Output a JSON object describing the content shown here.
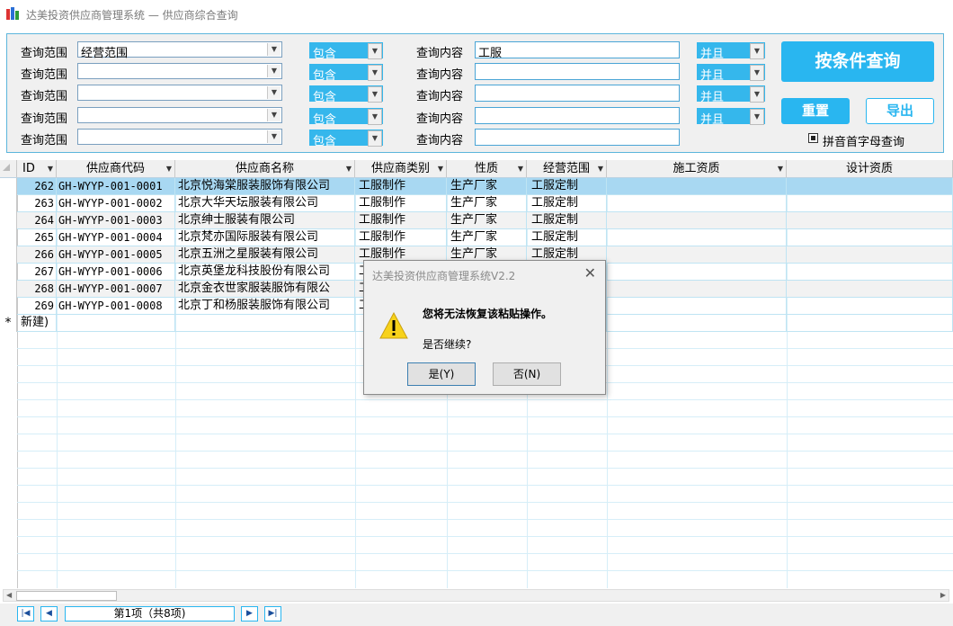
{
  "window": {
    "title": "达美投资供应商管理系统 — 供应商综合查询"
  },
  "search": {
    "rows": [
      {
        "range_label": "查询范围",
        "range_value": "经营范围",
        "op": "包含",
        "content_label": "查询内容",
        "content_value": "工服",
        "logic": "并且"
      },
      {
        "range_label": "查询范围",
        "range_value": "",
        "op": "包含",
        "content_label": "查询内容",
        "content_value": "",
        "logic": "并且"
      },
      {
        "range_label": "查询范围",
        "range_value": "",
        "op": "包含",
        "content_label": "查询内容",
        "content_value": "",
        "logic": "并且"
      },
      {
        "range_label": "查询范围",
        "range_value": "",
        "op": "包含",
        "content_label": "查询内容",
        "content_value": "",
        "logic": "并且"
      },
      {
        "range_label": "查询范围",
        "range_value": "",
        "op": "包含",
        "content_label": "查询内容",
        "content_value": ""
      }
    ],
    "query_button": "按条件查询",
    "reset_button": "重置",
    "export_button": "导出",
    "pinyin_label": "拼音首字母查询",
    "pinyin_checked": true
  },
  "grid": {
    "columns": [
      "ID",
      "供应商代码",
      "供应商名称",
      "供应商类别",
      "性质",
      "经营范围",
      "施工资质",
      "设计资质"
    ],
    "rows": [
      {
        "id": "262",
        "code": "GH-WYYP-001-0001",
        "name": "北京悦海棠服装服饰有限公司",
        "category": "工服制作",
        "nature": "生产厂家",
        "scope": "工服定制"
      },
      {
        "id": "263",
        "code": "GH-WYYP-001-0002",
        "name": "北京大华天坛服装有限公司",
        "category": "工服制作",
        "nature": "生产厂家",
        "scope": "工服定制"
      },
      {
        "id": "264",
        "code": "GH-WYYP-001-0003",
        "name": "北京绅士服装有限公司",
        "category": "工服制作",
        "nature": "生产厂家",
        "scope": "工服定制"
      },
      {
        "id": "265",
        "code": "GH-WYYP-001-0004",
        "name": "北京梵亦国际服装有限公司",
        "category": "工服制作",
        "nature": "生产厂家",
        "scope": "工服定制"
      },
      {
        "id": "266",
        "code": "GH-WYYP-001-0005",
        "name": "北京五洲之星服装有限公司",
        "category": "工服制作",
        "nature": "生产厂家",
        "scope": "工服定制"
      },
      {
        "id": "267",
        "code": "GH-WYYP-001-0006",
        "name": "北京英堡龙科技股份有限公司",
        "category": "工",
        "nature": "",
        "scope": ""
      },
      {
        "id": "268",
        "code": "GH-WYYP-001-0007",
        "name": "北京金衣世家服装服饰有限公",
        "category": "工",
        "nature": "",
        "scope": ""
      },
      {
        "id": "269",
        "code": "GH-WYYP-001-0008",
        "name": "北京丁和杨服装服饰有限公司",
        "category": "工",
        "nature": "",
        "scope": ""
      }
    ],
    "new_row_marker": "*",
    "new_row_label": "新建)"
  },
  "nav": {
    "record_text": "第1项（共8项)"
  },
  "dialog": {
    "title": "达美投资供应商管理系统V2.2",
    "message": "您将无法恢复该粘贴操作。",
    "question": "是否继续?",
    "yes": "是(Y)",
    "no": "否(N)"
  },
  "colors": {
    "accent": "#29b6f0",
    "selected_row": "#a8d8f2",
    "panel_border": "#5cb6dc"
  },
  "icons": [
    "app-icon",
    "dropdown-arrow-icon",
    "warning-icon",
    "close-icon",
    "first-record-icon",
    "prev-record-icon",
    "next-record-icon",
    "last-record-icon"
  ]
}
